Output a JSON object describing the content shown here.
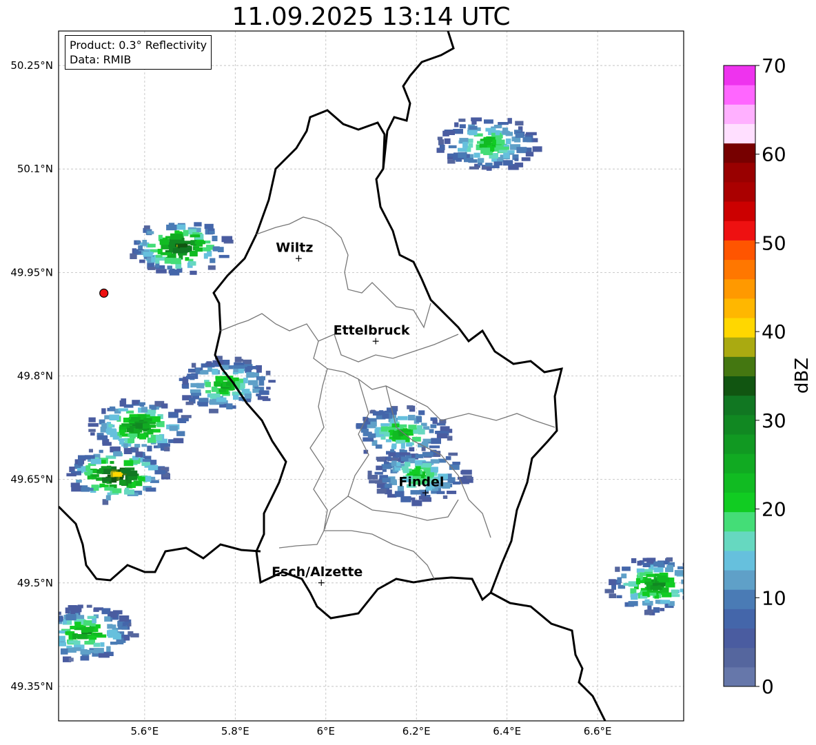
{
  "title": "11.09.2025 13:14 UTC",
  "info": {
    "product": "Product: 0.3° Reflectivity",
    "data": "Data: RMIB"
  },
  "map": {
    "lon_range": [
      5.41,
      6.79
    ],
    "lat_range": [
      49.3,
      50.3
    ],
    "xticks": [
      {
        "value": 5.6,
        "label": "5.6°E"
      },
      {
        "value": 5.8,
        "label": "5.8°E"
      },
      {
        "value": 6.0,
        "label": "6°E"
      },
      {
        "value": 6.2,
        "label": "6.2°E"
      },
      {
        "value": 6.4,
        "label": "6.4°E"
      },
      {
        "value": 6.6,
        "label": "6.6°E"
      }
    ],
    "yticks": [
      {
        "value": 49.35,
        "label": "49.35°N"
      },
      {
        "value": 49.5,
        "label": "49.5°N"
      },
      {
        "value": 49.65,
        "label": "49.65°N"
      },
      {
        "value": 49.8,
        "label": "49.8°N"
      },
      {
        "value": 49.95,
        "label": "49.95°N"
      },
      {
        "value": 50.1,
        "label": "50.1°N"
      },
      {
        "value": 50.25,
        "label": "50.25°N"
      }
    ],
    "grid": true,
    "cities": [
      {
        "name": "Wiltz",
        "lon": 5.94,
        "lat": 49.97
      },
      {
        "name": "Ettelbruck",
        "lon": 6.11,
        "lat": 49.85
      },
      {
        "name": "Findel",
        "lon": 6.22,
        "lat": 49.63
      },
      {
        "name": "Esch/Alzette",
        "lon": 5.99,
        "lat": 49.5
      }
    ],
    "radar_site": {
      "lon": 5.51,
      "lat": 49.92
    },
    "echo_cells": [
      {
        "lon": 5.46,
        "lat": 49.43,
        "max_dbz": 28
      },
      {
        "lon": 5.53,
        "lat": 49.66,
        "max_dbz": 42
      },
      {
        "lon": 5.58,
        "lat": 49.73,
        "max_dbz": 32
      },
      {
        "lon": 5.77,
        "lat": 49.79,
        "max_dbz": 25
      },
      {
        "lon": 5.67,
        "lat": 49.99,
        "max_dbz": 38
      },
      {
        "lon": 6.16,
        "lat": 49.72,
        "max_dbz": 24
      },
      {
        "lon": 6.2,
        "lat": 49.66,
        "max_dbz": 22
      },
      {
        "lon": 6.35,
        "lat": 50.14,
        "max_dbz": 24
      },
      {
        "lon": 6.72,
        "lat": 49.5,
        "max_dbz": 30
      }
    ]
  },
  "colorbar": {
    "label": "dBZ",
    "min": 0,
    "max": 70,
    "step": 2.5,
    "ticks": [
      "0",
      "10",
      "20",
      "30",
      "40",
      "50",
      "60",
      "70"
    ],
    "colors": [
      "#6677aa",
      "#55669e",
      "#4a5ca0",
      "#4466aa",
      "#4a7bb5",
      "#5fa0c8",
      "#66c0dd",
      "#66d8c0",
      "#44dd77",
      "#11cc22",
      "#11bb22",
      "#11aa22",
      "#119922",
      "#118822",
      "#117722",
      "#115511",
      "#447711",
      "#aaaa11",
      "#ffd700",
      "#ffb700",
      "#ff9900",
      "#ff7700",
      "#ff5500",
      "#ee1111",
      "#cc0000",
      "#aa0000",
      "#990000",
      "#770000",
      "#ffdfff",
      "#ffb0ff",
      "#ff66ff",
      "#ee33ee"
    ]
  }
}
